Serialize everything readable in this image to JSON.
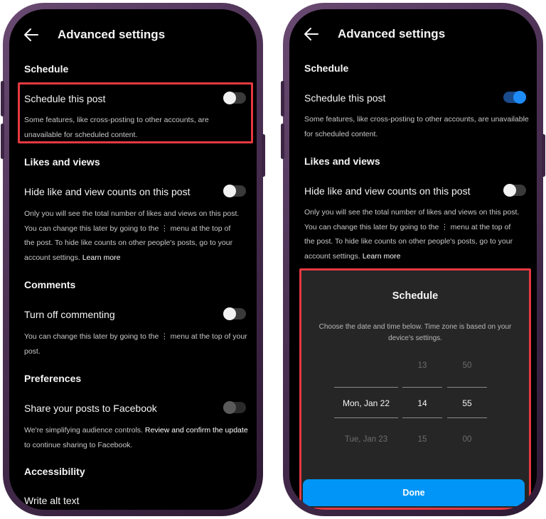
{
  "left": {
    "header": {
      "title": "Advanced settings"
    },
    "schedule": {
      "section": "Schedule",
      "label": "Schedule this post",
      "desc": "Some features, like cross-posting to other accounts, are unavailable for scheduled content."
    },
    "likes": {
      "section": "Likes and views",
      "label": "Hide like and view counts on this post",
      "desc_line1": "Only you will see the total number of likes and views on this post.",
      "desc_line2": "You can change this later by going to the ⋮ menu at the top of",
      "desc_line3": "the post. To hide like counts on other people's posts, go to your",
      "desc_line4": "account settings.",
      "link": "Learn more"
    },
    "comments": {
      "section": "Comments",
      "label": "Turn off commenting",
      "desc_line1": "You can change this later by going to the ⋮ menu at the top of your",
      "desc_line2": "post."
    },
    "preferences": {
      "section": "Preferences",
      "label": "Share your posts to Facebook",
      "desc_prefix": "We're simplifying audience controls.",
      "desc_link": "Review and confirm the update",
      "desc_line2": "to continue sharing to Facebook."
    },
    "accessibility": {
      "section": "Accessibility",
      "label": "Write alt text"
    }
  },
  "right": {
    "header": {
      "title": "Advanced settings"
    },
    "schedule": {
      "section": "Schedule",
      "label": "Schedule this post",
      "desc_line1": "Some features, like cross-posting to other accounts, are unavailable",
      "desc_line2": "for scheduled content."
    },
    "likes": {
      "section": "Likes and views",
      "label": "Hide like and view counts on this post",
      "desc_line1": "Only you will see the total number of likes and views on this post.",
      "desc_line2": "You can change this later by going to the ⋮ menu at the top of",
      "desc_line3": "the post. To hide like counts on other people's posts, go to your",
      "desc_line4": "account settings.",
      "link": "Learn more"
    },
    "sheet": {
      "title": "Schedule",
      "desc_line1": "Choose the date and time below. Time zone is based on your",
      "desc_line2": "device's settings.",
      "picker": {
        "date_prev": "",
        "date_sel": "Mon, Jan 22",
        "date_next": "Tue, Jan 23",
        "hour_prev": "13",
        "hour_sel": "14",
        "hour_next": "15",
        "min_prev": "50",
        "min_sel": "55",
        "min_next": "00"
      },
      "done_label": "Done"
    }
  },
  "colors": {
    "background": "#000000",
    "highlight": "#e53940",
    "accent_blue": "#0095f6",
    "sheet_bg": "#262626"
  },
  "toggles": {
    "left_schedule": "off",
    "left_hide_likes": "off",
    "left_comments": "off",
    "left_facebook": "disabled",
    "right_schedule": "on",
    "right_hide_likes": "off"
  }
}
